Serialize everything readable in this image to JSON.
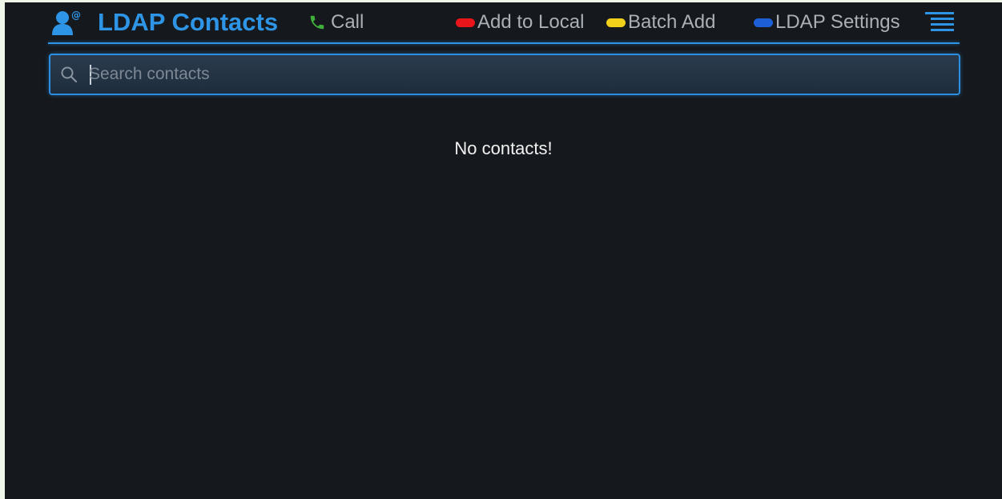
{
  "header": {
    "title": "LDAP Contacts",
    "app_icon": "contact-at-icon",
    "menu_icon": "menu-lines-icon"
  },
  "softkeys": {
    "call": {
      "label": "Call",
      "icon": "phone-icon",
      "color": "#3fae3a"
    },
    "add_to_local": {
      "label": "Add to Local",
      "color": "#e8151b"
    },
    "batch_add": {
      "label": "Batch Add",
      "color": "#f2d11a"
    },
    "ldap_settings": {
      "label": "LDAP Settings",
      "color": "#1d5fd6"
    }
  },
  "search": {
    "placeholder": "Search contacts",
    "value": "",
    "icon": "search-icon"
  },
  "main": {
    "empty_message": "No contacts!"
  },
  "colors": {
    "accent": "#2e95e6",
    "background": "#15181c"
  }
}
